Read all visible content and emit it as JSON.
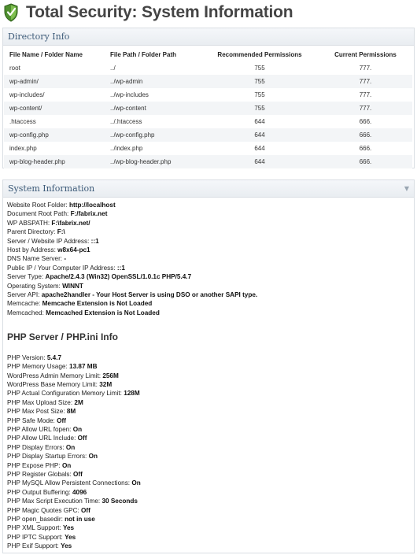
{
  "header": {
    "title": "Total Security: System Information"
  },
  "directory_panel": {
    "title": "Directory Info",
    "columns": [
      "File Name / Folder Name",
      "File Path / Folder Path",
      "Recommended Permissions",
      "Current Permissions"
    ],
    "rows": [
      [
        "root",
        "../",
        "755",
        "777."
      ],
      [
        "wp-admin/",
        "../wp-admin",
        "755",
        "777."
      ],
      [
        "wp-includes/",
        "../wp-includes",
        "755",
        "777."
      ],
      [
        "wp-content/",
        "../wp-content",
        "755",
        "777."
      ],
      [
        ".htaccess",
        "../.htaccess",
        "644",
        "666."
      ],
      [
        "wp-config.php",
        "../wp-config.php",
        "644",
        "666."
      ],
      [
        "index.php",
        "../index.php",
        "644",
        "666."
      ],
      [
        "wp-blog-header.php",
        "../wp-blog-header.php",
        "644",
        "666."
      ]
    ]
  },
  "system_panel": {
    "title": "System Information",
    "server_items": [
      {
        "label": "Website Root Folder: ",
        "value": "http://localhost"
      },
      {
        "label": "Document Root Path: ",
        "value": "F:/fabrix.net"
      },
      {
        "label": "WP ABSPATH: ",
        "value": "F:\\fabrix.net/"
      },
      {
        "label": "Parent Directory: ",
        "value": "F:\\"
      },
      {
        "label": "Server / Website IP Address: ",
        "value": "::1"
      },
      {
        "label": "Host by Address: ",
        "value": "w8x64-pc1"
      },
      {
        "label": "DNS Name Server: ",
        "value": "-"
      },
      {
        "label": "Public IP / Your Computer IP Address: ",
        "value": "::1"
      },
      {
        "label": "Server Type: ",
        "value": "Apache/2.4.3 (Win32) OpenSSL/1.0.1c PHP/5.4.7"
      },
      {
        "label": "Operating System: ",
        "value": "WINNT"
      },
      {
        "label": "Server API: ",
        "value": "apache2handler - Your Host Server is using DSO or another SAPI type."
      },
      {
        "label": "Memcache: ",
        "value": "Memcache Extension is Not Loaded"
      },
      {
        "label": "Memcached: ",
        "value": "Memcached Extension is Not Loaded"
      }
    ],
    "php_title": "PHP Server / PHP.ini Info",
    "php_items": [
      {
        "label": "PHP Version: ",
        "value": "5.4.7",
        "style": "plain"
      },
      {
        "label": "PHP Memory Usage: ",
        "value": "13.87 MB",
        "style": "plain"
      },
      {
        "label": "WordPress Admin Memory Limit: ",
        "value": "256M",
        "style": "plain"
      },
      {
        "label": "WordPress Base Memory Limit: ",
        "value": "32M",
        "style": "plain"
      },
      {
        "label": "PHP Actual Configuration Memory Limit: ",
        "value": "128M",
        "style": "plain"
      },
      {
        "label": "PHP Max Upload Size: ",
        "value": "2M",
        "style": "plain"
      },
      {
        "label": "PHP Max Post Size: ",
        "value": "8M",
        "style": "plain"
      },
      {
        "label": "PHP Safe Mode: ",
        "value": "Off",
        "style": "off"
      },
      {
        "label": "PHP Allow URL fopen: ",
        "value": "On",
        "style": "on"
      },
      {
        "label": "PHP Allow URL Include: ",
        "value": "Off",
        "style": "off"
      },
      {
        "label": "PHP Display Errors: ",
        "value": "On",
        "style": "on"
      },
      {
        "label": "PHP Display Startup Errors: ",
        "value": "On",
        "style": "on"
      },
      {
        "label": "PHP Expose PHP: ",
        "value": "On",
        "style": "on"
      },
      {
        "label": "PHP Register Globals: ",
        "value": "Off",
        "style": "off"
      },
      {
        "label": "PHP MySQL Allow Persistent Connections: ",
        "value": "On",
        "style": "on"
      },
      {
        "label": "PHP Output Buffering: ",
        "value": "4096",
        "style": "on"
      },
      {
        "label": "PHP Max Script Execution Time: ",
        "value": "30 Seconds",
        "style": "plain"
      },
      {
        "label": "PHP Magic Quotes GPC: ",
        "value": "Off",
        "style": "off"
      },
      {
        "label": "PHP open_basedir: ",
        "value": "not in use",
        "style": "plain"
      },
      {
        "label": "PHP XML Support: ",
        "value": "Yes",
        "style": "plain"
      },
      {
        "label": "PHP IPTC Support: ",
        "value": "Yes",
        "style": "plain"
      },
      {
        "label": "PHP Exif Support: ",
        "value": "Yes",
        "style": "plain"
      }
    ]
  },
  "colors": {
    "on": "#cc0000",
    "off": "#2e8b1e",
    "panel_title": "#3c5a78"
  },
  "icons": {
    "logo": "shield-check-icon",
    "collapse": "collapse-arrow-icon"
  }
}
